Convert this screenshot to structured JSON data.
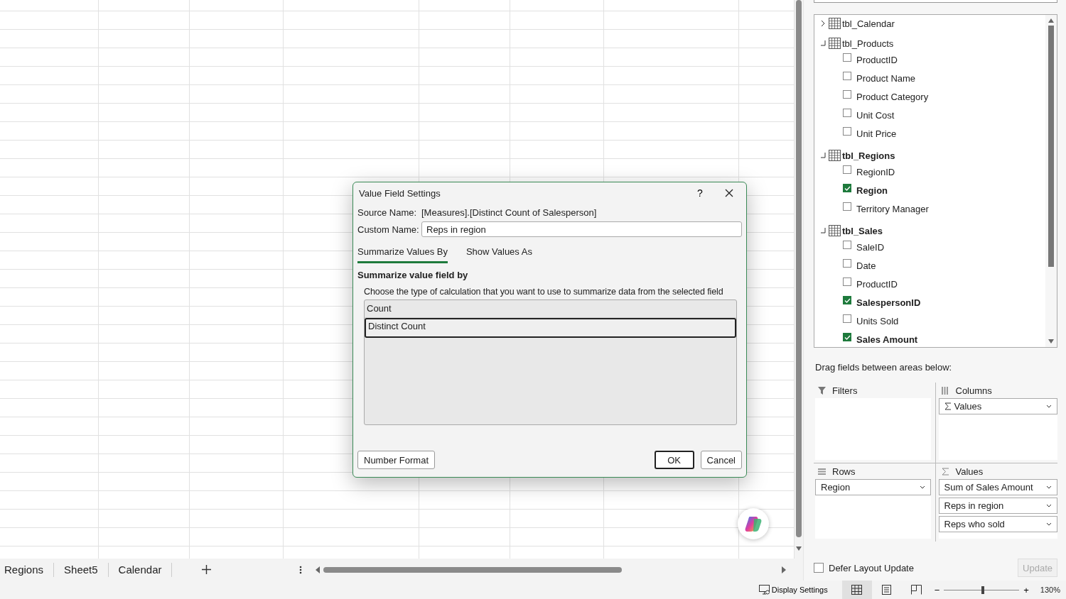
{
  "sheet_tabs": [
    {
      "label": "Regions"
    },
    {
      "label": "Sheet5"
    },
    {
      "label": "Calendar"
    }
  ],
  "dialog": {
    "title": "Value Field Settings",
    "help": "?",
    "source_label": "Source Name:",
    "source_value": "[Measures].[Distinct Count of Salesperson]",
    "custom_label": "Custom Name:",
    "custom_value": "Reps in region",
    "tabs": [
      {
        "label": "Summarize Values By",
        "selected": true
      },
      {
        "label": "Show Values As",
        "selected": false
      }
    ],
    "section_title": "Summarize value field by",
    "instruction": "Choose the type of calculation that you want to use to summarize data from the selected field",
    "functions": [
      {
        "label": "Count",
        "selected": false
      },
      {
        "label": "Distinct Count",
        "selected": true
      }
    ],
    "buttons": [
      {
        "label": "Number Format",
        "kind": "left"
      },
      {
        "label": "OK",
        "kind": "default"
      },
      {
        "label": "Cancel",
        "kind": "plain"
      }
    ]
  },
  "field_list": {
    "tables": [
      {
        "name": "tbl_Calendar",
        "expanded": false
      },
      {
        "name": "tbl_Products",
        "expanded": true,
        "fields": [
          {
            "name": "ProductID",
            "checked": false
          },
          {
            "name": "Product Name",
            "checked": false
          },
          {
            "name": "Product Category",
            "checked": false
          },
          {
            "name": "Unit Cost",
            "checked": false
          },
          {
            "name": "Unit Price",
            "checked": false
          }
        ]
      },
      {
        "name": "tbl_Regions",
        "expanded": true,
        "fields": [
          {
            "name": "RegionID",
            "checked": false
          },
          {
            "name": "Region",
            "checked": true
          },
          {
            "name": "Territory Manager",
            "checked": false
          }
        ]
      },
      {
        "name": "tbl_Sales",
        "expanded": true,
        "fields": [
          {
            "name": "SaleID",
            "checked": false
          },
          {
            "name": "Date",
            "checked": false
          },
          {
            "name": "ProductID",
            "checked": false
          },
          {
            "name": "SalespersonID",
            "checked": true
          },
          {
            "name": "Units Sold",
            "checked": false
          },
          {
            "name": "Sales Amount",
            "checked": true
          }
        ]
      }
    ]
  },
  "areas": {
    "hint": "Drag fields between areas below:",
    "zones": [
      {
        "kind": "filters",
        "title": "Filters"
      },
      {
        "kind": "columns",
        "title": "Columns",
        "items": [
          {
            "label": "Values",
            "sigma": true
          }
        ]
      },
      {
        "kind": "rows",
        "title": "Rows",
        "items": [
          {
            "label": "Region",
            "sigma": false
          }
        ]
      },
      {
        "kind": "values",
        "title": "Values",
        "items": [
          {
            "label": "Sum of Sales Amount",
            "sigma": false
          },
          {
            "label": "Reps in region",
            "sigma": false
          },
          {
            "label": "Reps who sold",
            "sigma": false
          }
        ]
      }
    ],
    "defer": {
      "label": "Defer Layout Update",
      "checked": false
    },
    "update": "Update"
  },
  "status_bar": {
    "display_settings": "Display Settings",
    "views": [
      {
        "kind": "normal",
        "selected": true
      },
      {
        "kind": "page_layout",
        "selected": false
      },
      {
        "kind": "page_break",
        "selected": false
      }
    ],
    "zoom": {
      "minus": "−",
      "plus": "+",
      "level": 0.52,
      "reading": "130%"
    }
  }
}
